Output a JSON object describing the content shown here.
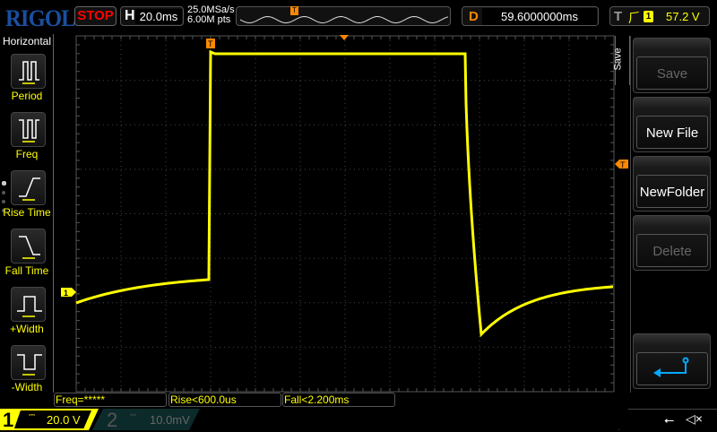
{
  "brand": "RIGOL",
  "run_state": "STOP",
  "horizontal": {
    "label": "H",
    "timebase": "20.0ms",
    "sample_rate": "25.0MSa/s",
    "memory_depth": "6.00M pts"
  },
  "delay": {
    "label": "D",
    "value": "59.6000000ms"
  },
  "trigger": {
    "label": "T",
    "edge": "rising-edge-icon",
    "source": "1",
    "level": "57.2 V",
    "marker": "T"
  },
  "left_menu": {
    "title": "Horizontal",
    "items": [
      {
        "label": "Period",
        "icon": "period-icon"
      },
      {
        "label": "Freq",
        "icon": "frequency-icon"
      },
      {
        "label": "Rise Time",
        "icon": "rise-time-icon"
      },
      {
        "label": "Fall Time",
        "icon": "fall-time-icon"
      },
      {
        "label": "+Width",
        "icon": "positive-width-icon"
      },
      {
        "label": "-Width",
        "icon": "negative-width-icon"
      }
    ]
  },
  "right_menu": {
    "title": "Save",
    "items": [
      {
        "label": "Save",
        "enabled": false
      },
      {
        "label": "New File",
        "enabled": true
      },
      {
        "label": "NewFolder",
        "enabled": true
      },
      {
        "label": "Delete",
        "enabled": false
      }
    ],
    "back_icon": "return-arrow-icon"
  },
  "measurements": [
    "Freq=*****",
    "Rise<600.0us",
    "Fall<2.200ms"
  ],
  "channels": [
    {
      "num": "1",
      "coupling": "DC",
      "scale": "20.0 V",
      "active": true,
      "color": "#ffff00"
    },
    {
      "num": "2",
      "coupling": "DC",
      "scale": "10.0mV",
      "active": false,
      "color": "#555555"
    }
  ],
  "channel_marker": "1",
  "status_icons": [
    "usb-icon",
    "speaker-muted-icon"
  ],
  "colors": {
    "ch1": "#ffff00",
    "trigger": "#ff8800",
    "back": "#00aaff",
    "brand": "#1a4fa0",
    "stop": "#ff0000"
  }
}
